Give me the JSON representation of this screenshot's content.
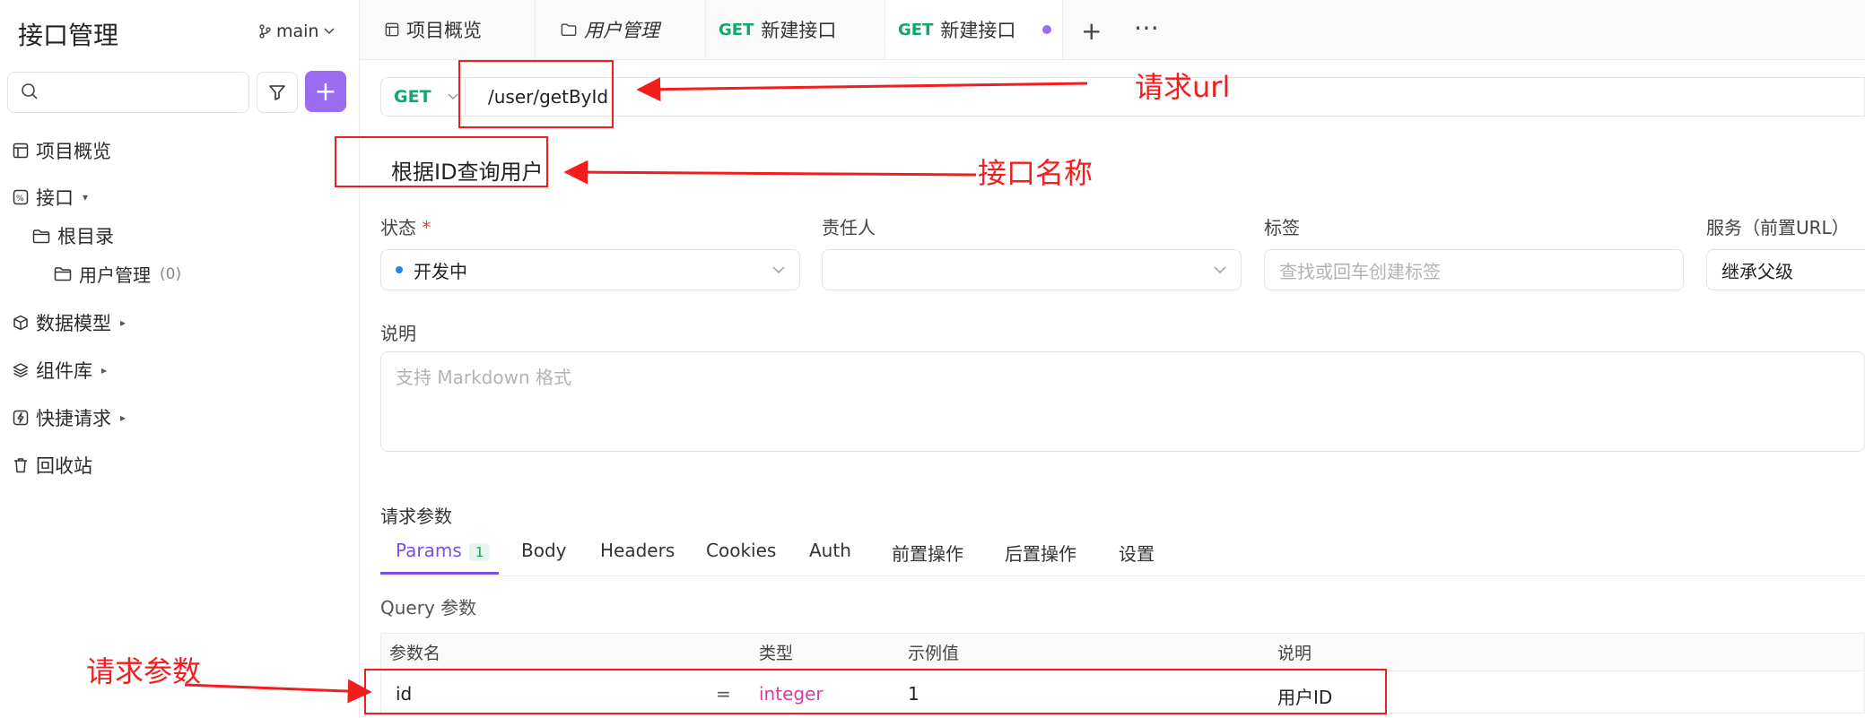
{
  "sidebar": {
    "title": "接口管理",
    "branch": "main",
    "items": [
      {
        "label": "项目概览"
      },
      {
        "label": "接口"
      },
      {
        "label": "根目录"
      },
      {
        "label": "用户管理",
        "count": "(0)"
      },
      {
        "label": "数据模型"
      },
      {
        "label": "组件库"
      },
      {
        "label": "快捷请求"
      },
      {
        "label": "回收站"
      }
    ]
  },
  "tabs": [
    {
      "label": "项目概览"
    },
    {
      "label": "用户管理"
    },
    {
      "method": "GET",
      "label": "新建接口"
    },
    {
      "method": "GET",
      "label": "新建接口"
    }
  ],
  "request": {
    "method": "GET",
    "url": "/user/getById",
    "name": "根据ID查询用户"
  },
  "fields": {
    "status_label": "状态",
    "required_mark": "*",
    "status_value": "开发中",
    "owner_label": "责任人",
    "tags_label": "标签",
    "tags_placeholder": "查找或回车创建标签",
    "service_label": "服务（前置URL）",
    "service_value": "继承父级",
    "desc_label": "说明",
    "desc_placeholder": "支持 Markdown 格式"
  },
  "params": {
    "section_title": "请求参数",
    "tabs": [
      "Params",
      "Body",
      "Headers",
      "Cookies",
      "Auth",
      "前置操作",
      "后置操作",
      "设置"
    ],
    "params_count": "1",
    "query_title": "Query 参数",
    "columns": [
      "参数名",
      "类型",
      "示例值",
      "说明"
    ],
    "rows": [
      {
        "name": "id",
        "eq": "=",
        "type": "integer",
        "example": "1",
        "desc": "用户ID"
      }
    ]
  },
  "annotations": {
    "url": "请求url",
    "name": "接口名称",
    "params": "请求参数"
  },
  "colors": {
    "accent": "#9b6cf0",
    "get": "#11a86b",
    "annotation": "#f21d1d"
  }
}
